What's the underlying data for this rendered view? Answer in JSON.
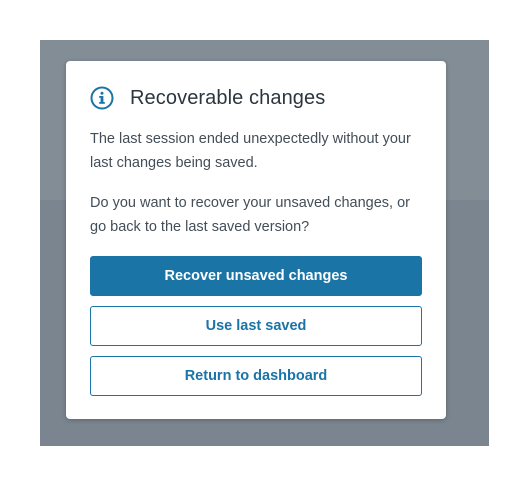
{
  "dialog": {
    "title": "Recoverable changes",
    "icon": "info-icon",
    "message_1": "The last session ended unexpectedly without your last changes being saved.",
    "message_2": "Do you want to recover your unsaved changes, or go back to the last saved version?",
    "primary_button": "Recover unsaved changes",
    "secondary_button": "Use last saved",
    "tertiary_button": "Return to dashboard"
  },
  "colors": {
    "accent": "#1a74a6",
    "backdrop": "#7a858f",
    "title_text": "#2b3640",
    "body_text": "#434e58"
  }
}
